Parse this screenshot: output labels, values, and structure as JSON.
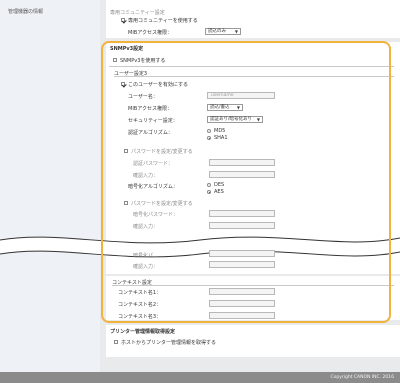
{
  "nav": {
    "selected_item": "管理機器の情報"
  },
  "top": {
    "section_title": "専用コミュニティー設定",
    "use_community_label": "専用コミュニティーを使用する",
    "mib_access_label": "MIBアクセス権限：",
    "mib_access_value": "読込のみ"
  },
  "snmpv3": {
    "title": "SNMPv3設定",
    "use_label": "SNMPv3を使用する",
    "user_settings_title": "ユーザー設定3",
    "enable_user_label": "このユーザーを有効にする",
    "username_label": "ユーザー名：",
    "username_placeholder": "username",
    "mib_access_label": "MIBアクセス権限：",
    "mib_access_value": "読込/書込",
    "security_label": "セキュリティー設定：",
    "security_value": "認証あり/暗号化あり",
    "auth_algo_label": "認証アルゴリズム：",
    "auth_algo_options": [
      "MD5",
      "SHA1"
    ],
    "set_auth_password_label": "パスワードを設定/変更する",
    "auth_password_label": "認証パスワード：",
    "confirm1_label": "確認入力：",
    "enc_algo_label": "暗号化アルゴリズム：",
    "enc_algo_options": [
      "DES",
      "AES"
    ],
    "set_enc_password_label": "パスワードを設定/変更する",
    "enc_password_label": "暗号化パスワード：",
    "confirm2_label": "確認入力：",
    "partial_label": "暗号化パ...",
    "confirm3_label": "確認入力："
  },
  "context": {
    "title": "コンテキスト設定",
    "name1_label": "コンテキスト名1：",
    "name2_label": "コンテキスト名2：",
    "name3_label": "コンテキスト名3："
  },
  "printer_mgmt": {
    "title": "プリンター管理情報取得設定",
    "get_from_host_label": "ホストからプリンター管理情報を取得する"
  },
  "footer": {
    "copyright": "Copyright CANON INC. 2016"
  },
  "colors": {
    "highlight": "#f2b33d",
    "footer_bg": "#8b8b8b",
    "panel_bg": "#e9eaec"
  }
}
